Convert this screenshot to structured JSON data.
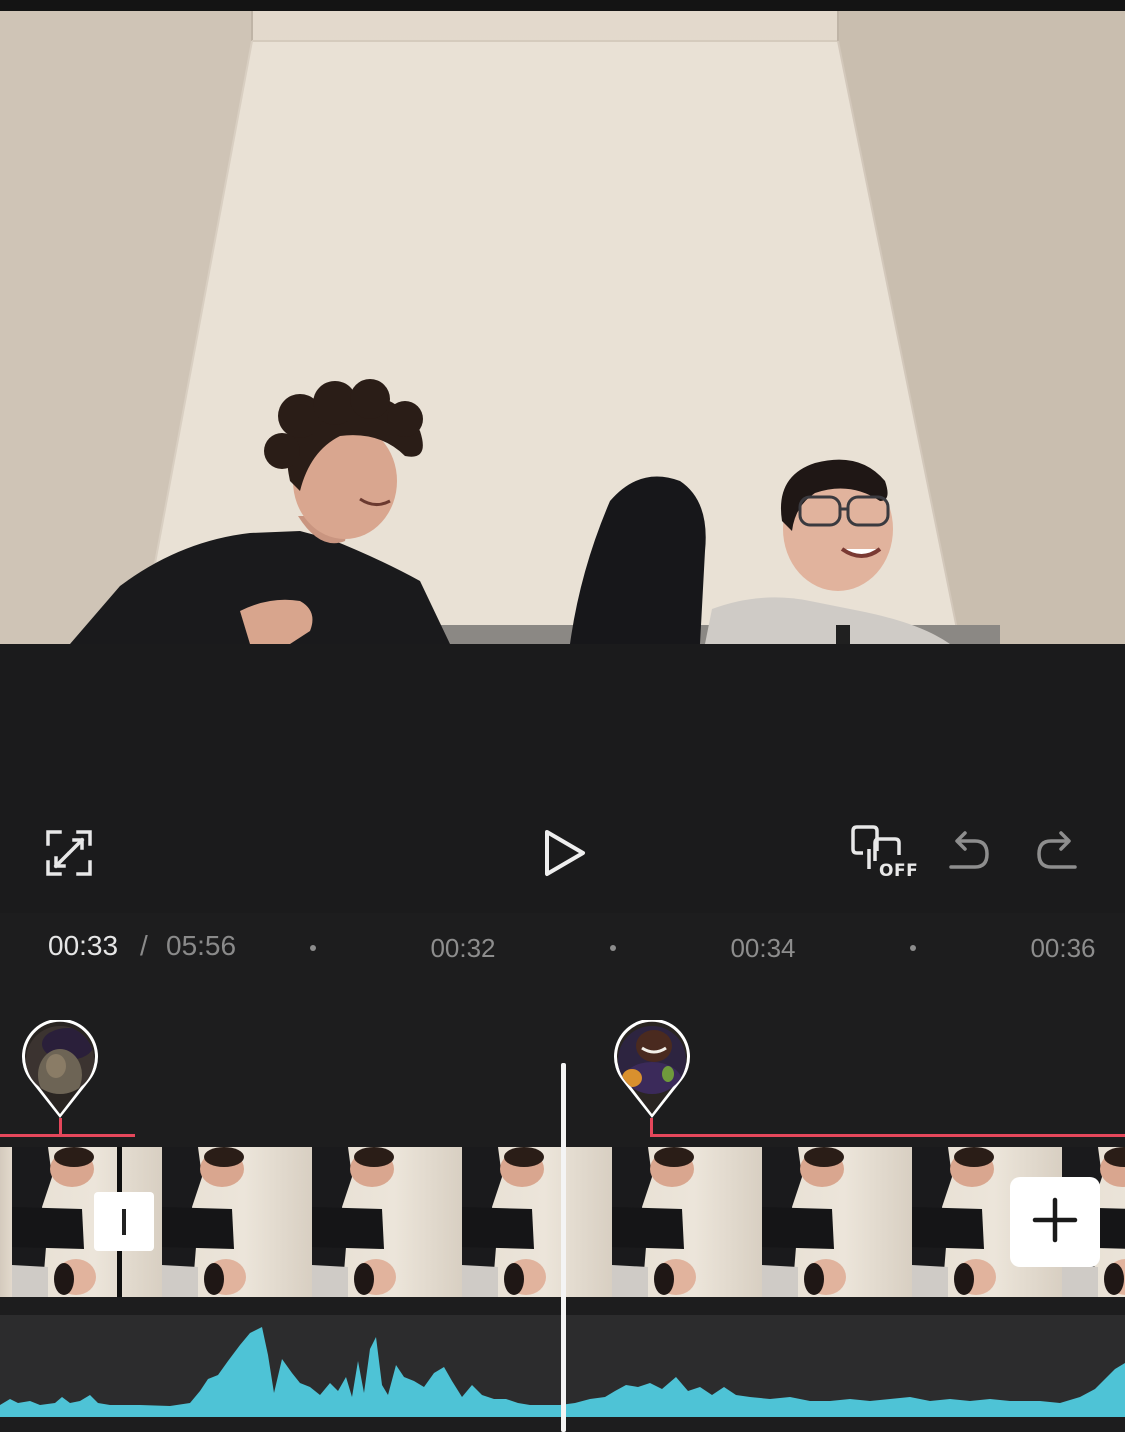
{
  "preview": {
    "description_icon": "video-preview"
  },
  "controls": {
    "fullscreen_icon": "fullscreen-icon",
    "play_icon": "play-icon",
    "keyframe_label": "OFF",
    "undo_icon": "undo-icon",
    "redo_icon": "redo-icon"
  },
  "timeline": {
    "current_time": "00:33",
    "separator": "/",
    "total_time": "05:56",
    "ticks": [
      "00:32",
      "00:34",
      "00:36"
    ]
  },
  "clips": {
    "transition_icon": "transition-icon",
    "add_icon": "plus-icon"
  },
  "colors": {
    "accent_red": "#e5475b",
    "waveform": "#4ec3d6",
    "background": "#1b1b1c"
  }
}
